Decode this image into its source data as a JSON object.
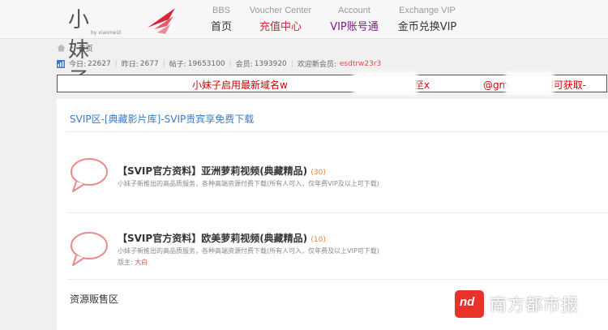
{
  "logo": {
    "title": "小妹子",
    "subtitle": "by xiaomeizi"
  },
  "nav": [
    {
      "en": "BBS",
      "cn": "首页"
    },
    {
      "en": "Voucher Center",
      "cn": "充值中心"
    },
    {
      "en": "Account",
      "cn": "VIP账号通"
    },
    {
      "en": "Exchange VIP",
      "cn": "金币兑换VIP"
    }
  ],
  "breadcrumb": {
    "sep": "›",
    "current": "首页"
  },
  "stats": {
    "today_label": "今日:",
    "today": "22627",
    "yesterday_label": "昨日:",
    "yesterday": "2677",
    "posts_label": "帖子:",
    "posts": "19653100",
    "members_label": "会员:",
    "members": "1393920",
    "newest_label": "欢迎新会员:",
    "newest": "esdtrw23r3"
  },
  "notice": {
    "part1": "小妹子启用最新域名w",
    "part2": "发送任意邮件至x",
    "part3": "@gmail.com即可获取-"
  },
  "section_title": "SVIP区-[典藏影片库]-SVIP贵宾享免费下载",
  "forums": [
    {
      "title": "【SVIP官方资料】亚洲萝莉视频(典藏精品)",
      "count": "(30)",
      "desc": "小妹子新推出的高品质服务，各种高端资源付费下载(所有人可入，仅年费VIP及以上可下载)"
    },
    {
      "title": "【SVIP官方资料】欧美萝莉视频(典藏精品)",
      "count": "(10)",
      "desc": "小妹子新推出的高品质服务，各种高端资源付费下载(所有人可入，仅年费及以上VIP可下载)",
      "mod_label": "版主:",
      "mod": "大白"
    }
  ],
  "section2_title": "资源贩售区",
  "watermark": {
    "logo": "nd",
    "text": "南方都市报"
  },
  "colors": {
    "accent_red": "#d9263a",
    "vip_purple": "#7a1d7f",
    "link_blue": "#3a7bc8",
    "count_orange": "#e6823a"
  }
}
